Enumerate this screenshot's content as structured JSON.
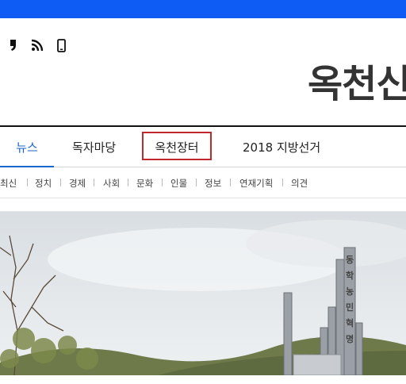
{
  "colors": {
    "topbar": "#0f5cf5",
    "active_nav": "#1a66c9",
    "highlight_box": "#c0282d"
  },
  "utility_icons": [
    "quote-icon",
    "rss-icon",
    "mobile-icon"
  ],
  "site": {
    "logo_text": "옥천신"
  },
  "main_nav": [
    {
      "label": "뉴스",
      "active": true
    },
    {
      "label": "독자마당",
      "active": false
    },
    {
      "label": "옥천장터",
      "active": false,
      "highlighted": true
    },
    {
      "label": "2018 지방선거",
      "active": false
    }
  ],
  "sub_nav": [
    "최신",
    "정치",
    "경제",
    "사회",
    "문화",
    "인물",
    "정보",
    "연재기획",
    "의견"
  ],
  "photo": {
    "sign_text": "동학농민혁명"
  }
}
